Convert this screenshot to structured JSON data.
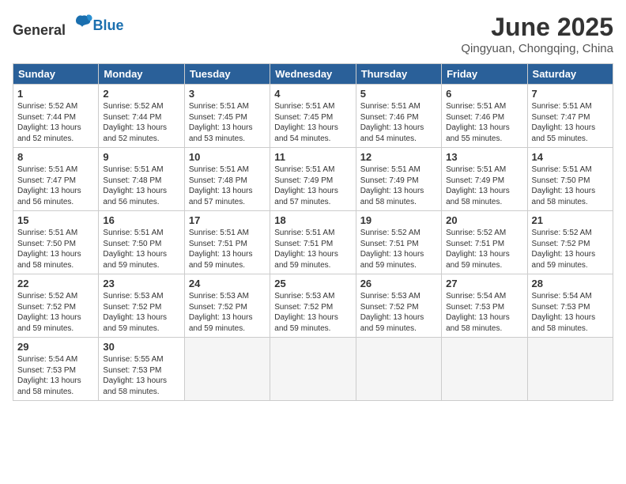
{
  "header": {
    "logo_general": "General",
    "logo_blue": "Blue",
    "month_title": "June 2025",
    "location": "Qingyuan, Chongqing, China"
  },
  "days_of_week": [
    "Sunday",
    "Monday",
    "Tuesday",
    "Wednesday",
    "Thursday",
    "Friday",
    "Saturday"
  ],
  "weeks": [
    [
      {
        "day": "1",
        "sunrise": "5:52 AM",
        "sunset": "7:44 PM",
        "daylight": "13 hours and 52 minutes."
      },
      {
        "day": "2",
        "sunrise": "5:52 AM",
        "sunset": "7:44 PM",
        "daylight": "13 hours and 52 minutes."
      },
      {
        "day": "3",
        "sunrise": "5:51 AM",
        "sunset": "7:45 PM",
        "daylight": "13 hours and 53 minutes."
      },
      {
        "day": "4",
        "sunrise": "5:51 AM",
        "sunset": "7:45 PM",
        "daylight": "13 hours and 54 minutes."
      },
      {
        "day": "5",
        "sunrise": "5:51 AM",
        "sunset": "7:46 PM",
        "daylight": "13 hours and 54 minutes."
      },
      {
        "day": "6",
        "sunrise": "5:51 AM",
        "sunset": "7:46 PM",
        "daylight": "13 hours and 55 minutes."
      },
      {
        "day": "7",
        "sunrise": "5:51 AM",
        "sunset": "7:47 PM",
        "daylight": "13 hours and 55 minutes."
      }
    ],
    [
      {
        "day": "8",
        "sunrise": "5:51 AM",
        "sunset": "7:47 PM",
        "daylight": "13 hours and 56 minutes."
      },
      {
        "day": "9",
        "sunrise": "5:51 AM",
        "sunset": "7:48 PM",
        "daylight": "13 hours and 56 minutes."
      },
      {
        "day": "10",
        "sunrise": "5:51 AM",
        "sunset": "7:48 PM",
        "daylight": "13 hours and 57 minutes."
      },
      {
        "day": "11",
        "sunrise": "5:51 AM",
        "sunset": "7:49 PM",
        "daylight": "13 hours and 57 minutes."
      },
      {
        "day": "12",
        "sunrise": "5:51 AM",
        "sunset": "7:49 PM",
        "daylight": "13 hours and 58 minutes."
      },
      {
        "day": "13",
        "sunrise": "5:51 AM",
        "sunset": "7:49 PM",
        "daylight": "13 hours and 58 minutes."
      },
      {
        "day": "14",
        "sunrise": "5:51 AM",
        "sunset": "7:50 PM",
        "daylight": "13 hours and 58 minutes."
      }
    ],
    [
      {
        "day": "15",
        "sunrise": "5:51 AM",
        "sunset": "7:50 PM",
        "daylight": "13 hours and 58 minutes."
      },
      {
        "day": "16",
        "sunrise": "5:51 AM",
        "sunset": "7:50 PM",
        "daylight": "13 hours and 59 minutes."
      },
      {
        "day": "17",
        "sunrise": "5:51 AM",
        "sunset": "7:51 PM",
        "daylight": "13 hours and 59 minutes."
      },
      {
        "day": "18",
        "sunrise": "5:51 AM",
        "sunset": "7:51 PM",
        "daylight": "13 hours and 59 minutes."
      },
      {
        "day": "19",
        "sunrise": "5:52 AM",
        "sunset": "7:51 PM",
        "daylight": "13 hours and 59 minutes."
      },
      {
        "day": "20",
        "sunrise": "5:52 AM",
        "sunset": "7:51 PM",
        "daylight": "13 hours and 59 minutes."
      },
      {
        "day": "21",
        "sunrise": "5:52 AM",
        "sunset": "7:52 PM",
        "daylight": "13 hours and 59 minutes."
      }
    ],
    [
      {
        "day": "22",
        "sunrise": "5:52 AM",
        "sunset": "7:52 PM",
        "daylight": "13 hours and 59 minutes."
      },
      {
        "day": "23",
        "sunrise": "5:53 AM",
        "sunset": "7:52 PM",
        "daylight": "13 hours and 59 minutes."
      },
      {
        "day": "24",
        "sunrise": "5:53 AM",
        "sunset": "7:52 PM",
        "daylight": "13 hours and 59 minutes."
      },
      {
        "day": "25",
        "sunrise": "5:53 AM",
        "sunset": "7:52 PM",
        "daylight": "13 hours and 59 minutes."
      },
      {
        "day": "26",
        "sunrise": "5:53 AM",
        "sunset": "7:52 PM",
        "daylight": "13 hours and 59 minutes."
      },
      {
        "day": "27",
        "sunrise": "5:54 AM",
        "sunset": "7:53 PM",
        "daylight": "13 hours and 58 minutes."
      },
      {
        "day": "28",
        "sunrise": "5:54 AM",
        "sunset": "7:53 PM",
        "daylight": "13 hours and 58 minutes."
      }
    ],
    [
      {
        "day": "29",
        "sunrise": "5:54 AM",
        "sunset": "7:53 PM",
        "daylight": "13 hours and 58 minutes."
      },
      {
        "day": "30",
        "sunrise": "5:55 AM",
        "sunset": "7:53 PM",
        "daylight": "13 hours and 58 minutes."
      },
      null,
      null,
      null,
      null,
      null
    ]
  ]
}
